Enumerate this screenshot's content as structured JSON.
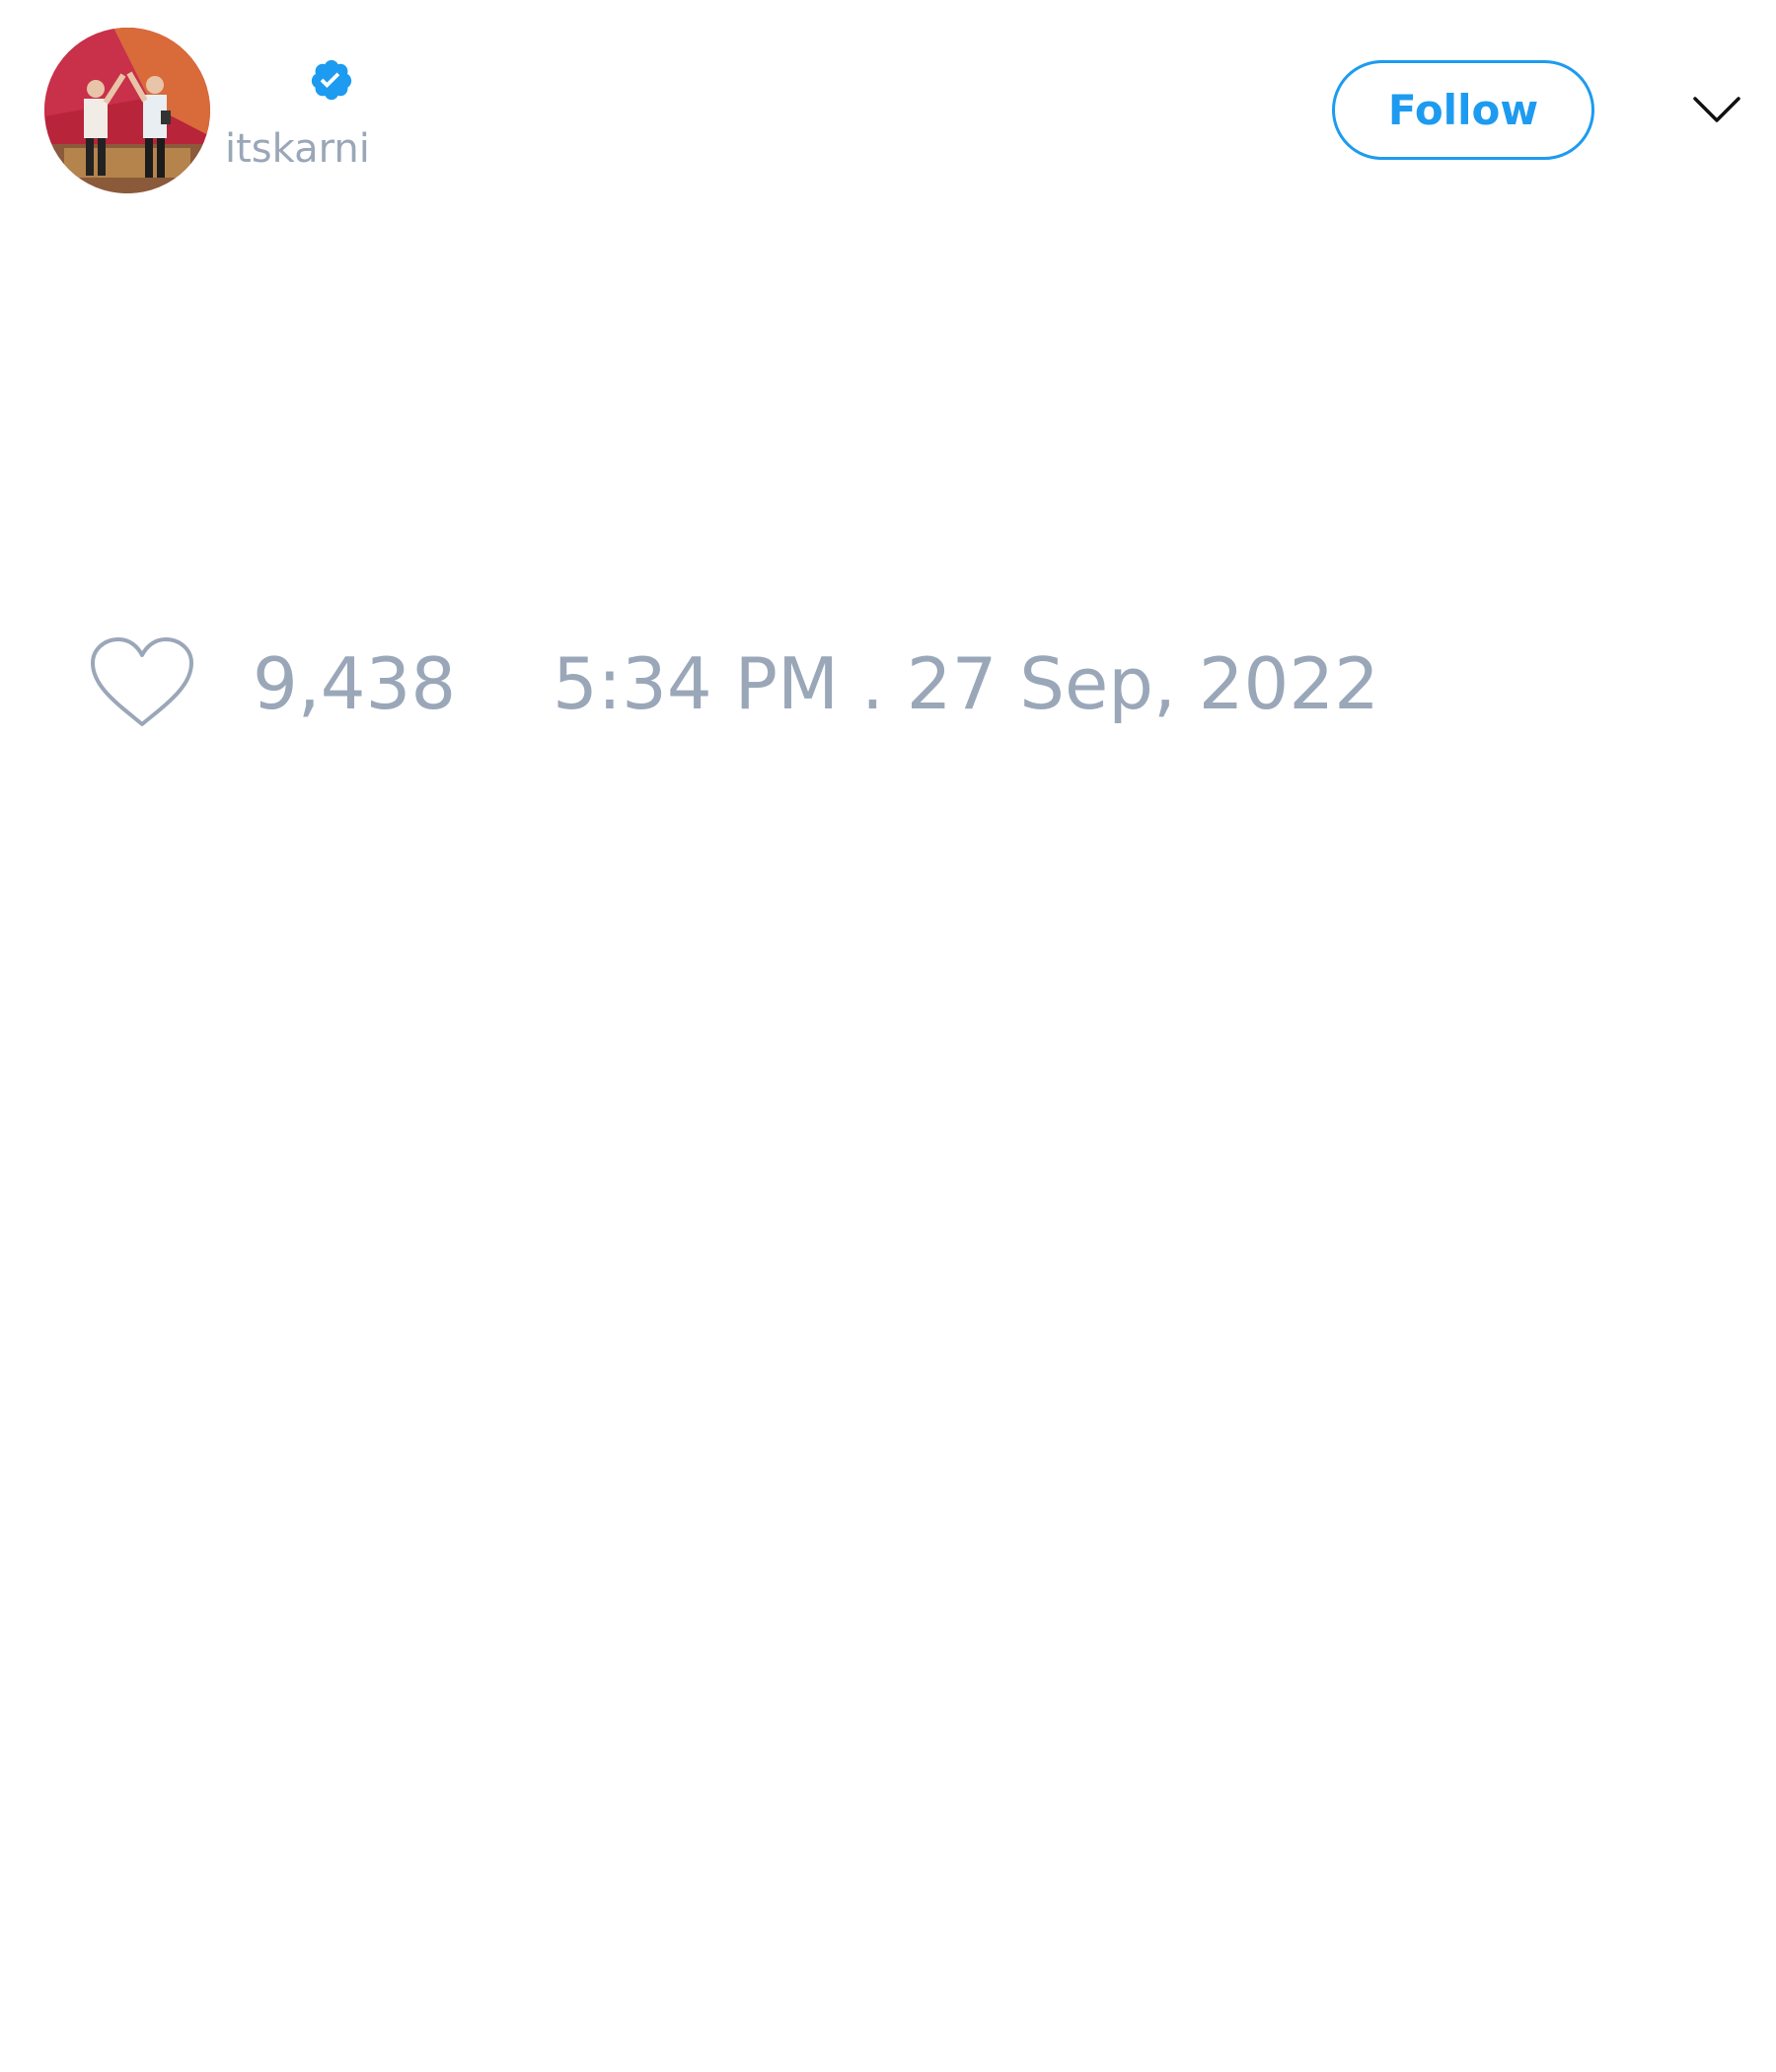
{
  "tweet": {
    "author": {
      "handle": "itskarni",
      "verified": true,
      "verified_color": "#1d9bf0"
    },
    "follow_label": "Follow",
    "menu_icon": "chevron-down-icon",
    "likes": "9,438",
    "timestamp": "5:34 PM . 27 Sep, 2022"
  },
  "colors": {
    "accent": "#1d9bf0",
    "muted_text": "#9aa7b8"
  }
}
